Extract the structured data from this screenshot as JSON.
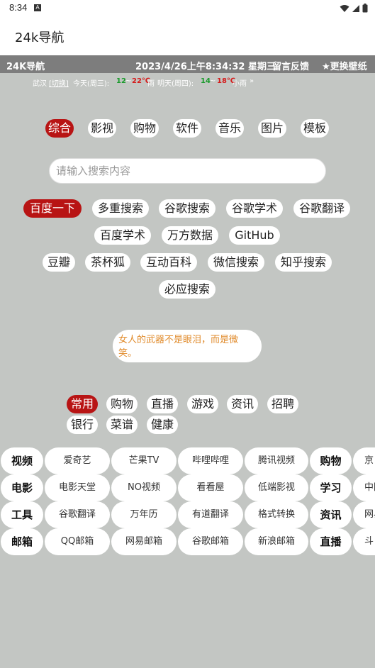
{
  "status": {
    "time": "8:34",
    "notif_glyph": "A"
  },
  "app": {
    "title": "24k导航"
  },
  "topbar": {
    "brand": "24K导航",
    "datetime": "2023/4/26上午8:34:32 星期三",
    "feedback": "留言反馈",
    "wallpaper": "★更换壁纸"
  },
  "weather": {
    "city": "武汉",
    "switch": "[切换]",
    "today_label": "今天(周三):",
    "today_low": "12",
    "tilde1": "~",
    "today_high": "22℃",
    "today_cond": "雨",
    "tomorrow_label": "明天(周四):",
    "tomorrow_low": "14",
    "tilde2": "~",
    "tomorrow_high": "18℃",
    "tomorrow_cond": "小雨",
    "more": "»"
  },
  "categories": [
    "综合",
    "影视",
    "购物",
    "软件",
    "音乐",
    "图片",
    "模板"
  ],
  "search": {
    "placeholder": "请输入搜索内容"
  },
  "engines": [
    "百度一下",
    "多重搜索",
    "谷歌搜索",
    "谷歌学术",
    "谷歌翻译",
    "百度学术",
    "万方数据",
    "GitHub",
    "豆瓣",
    "茶杯狐",
    "互动百科",
    "微信搜索",
    "知乎搜索",
    "必应搜索"
  ],
  "quote": "女人的武器不是眼泪，而是微笑。",
  "link_tabs": [
    "常用",
    "购物",
    "直播",
    "游戏",
    "资讯",
    "招聘",
    "银行",
    "菜谱",
    "健康"
  ],
  "grid": [
    [
      "视频",
      "爱奇艺",
      "芒果TV",
      "哔哩哔哩",
      "腾讯视频",
      "购物",
      "京"
    ],
    [
      "电影",
      "电影天堂",
      "NO视频",
      "看看屋",
      "低端影视",
      "学习",
      "中国"
    ],
    [
      "工具",
      "谷歌翻译",
      "万年历",
      "有道翻译",
      "格式转换",
      "资讯",
      "网易"
    ],
    [
      "邮箱",
      "QQ邮箱",
      "网易邮箱",
      "谷歌邮箱",
      "新浪邮箱",
      "直播",
      "斗"
    ]
  ],
  "colors": {
    "background": "#c3c6c3",
    "accent": "#b81414",
    "topbar": "#7d7d7d",
    "quote_text": "#e08a2a"
  }
}
